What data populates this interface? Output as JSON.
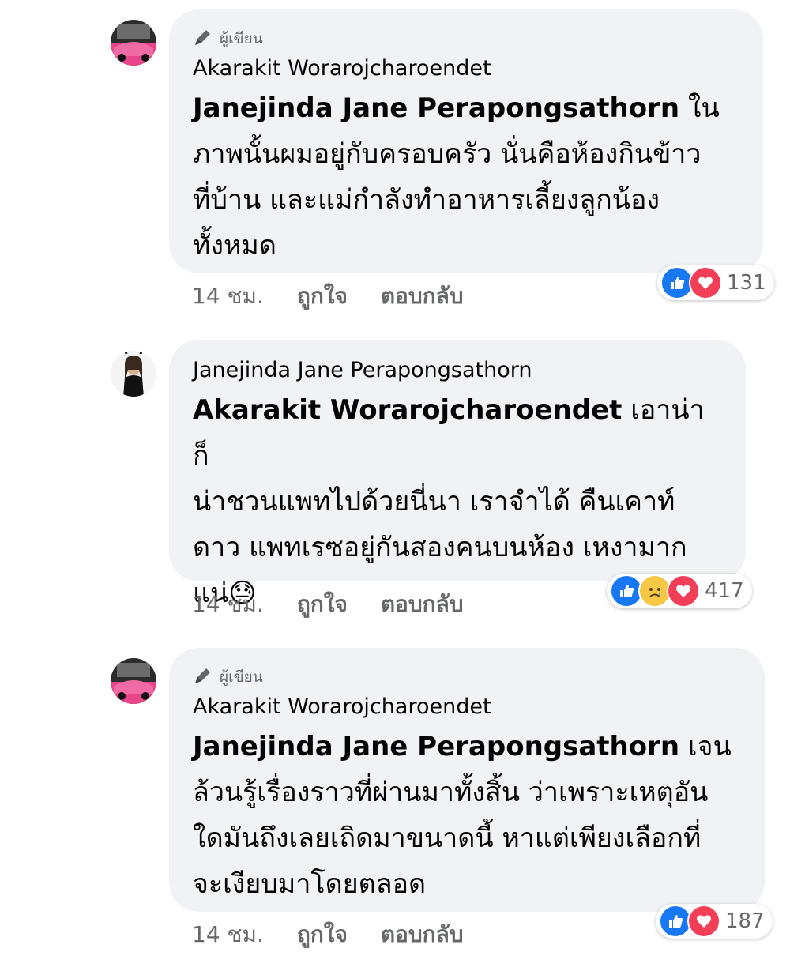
{
  "colors": {
    "bubble_bg": "#f0f2f5",
    "like_blue": "#1877f2",
    "love_red": "#f33e58",
    "sad_yellow": "#f7c846",
    "meta_gray": "#65676b"
  },
  "comments": [
    {
      "author_badge": "ผู้เขียน",
      "author_badge_icon": "pen-icon",
      "author": "Akarakit Woraroj­charoendet",
      "mention": "Janejinda Jane Perapongsathorn",
      "lines": [
        " ใน",
        "ภาพนั้นผมอยู่กับครอบครัว นั่นคือห้องกินข้าว",
        "ที่บ้าน และแม่กำลังทำอาหารเลี้ยงลูกน้อง",
        "ทั้งหมด"
      ],
      "time": "14 ชม.",
      "like_label": "ถูกใจ",
      "reply_label": "ตอบกลับ",
      "reactions": [
        "like-icon",
        "love-icon"
      ],
      "reaction_count": "131"
    },
    {
      "author": "Janejinda Jane Perapongsathorn",
      "mention": "Akarakit Woraroj­charoendet",
      "lines": [
        "  เอาน่า ก็",
        "น่าชวนแพทไปด้วยนี่นา เราจำได้ คืนเคาท์",
        "ดาว แพทเรซอยู่กันสองคนบนห้อง เหงามาก",
        "แน่😓"
      ],
      "time": "14 ชม.",
      "like_label": "ถูกใจ",
      "reply_label": "ตอบกลับ",
      "reactions": [
        "like-icon",
        "sad-icon",
        "love-icon"
      ],
      "reaction_count": "417"
    },
    {
      "author_badge": "ผู้เขียน",
      "author_badge_icon": "pen-icon",
      "author": "Akarakit Woraroj­charoendet",
      "mention": "Janejinda Jane Perapongsathorn",
      "lines": [
        " เจน",
        "ล้วนรู้เรื่องราวที่ผ่านมาทั้งสิ้น ว่าเพราะเหตุอัน",
        "ใดมันถึงเลยเถิดมาขนาดนี้ หาแต่เพียงเลือกที่",
        "จะเงียบมาโดยตลอด"
      ],
      "time": "14 ชม.",
      "like_label": "ถูกใจ",
      "reply_label": "ตอบกลับ",
      "reactions": [
        "like-icon",
        "love-icon"
      ],
      "reaction_count": "187"
    }
  ]
}
